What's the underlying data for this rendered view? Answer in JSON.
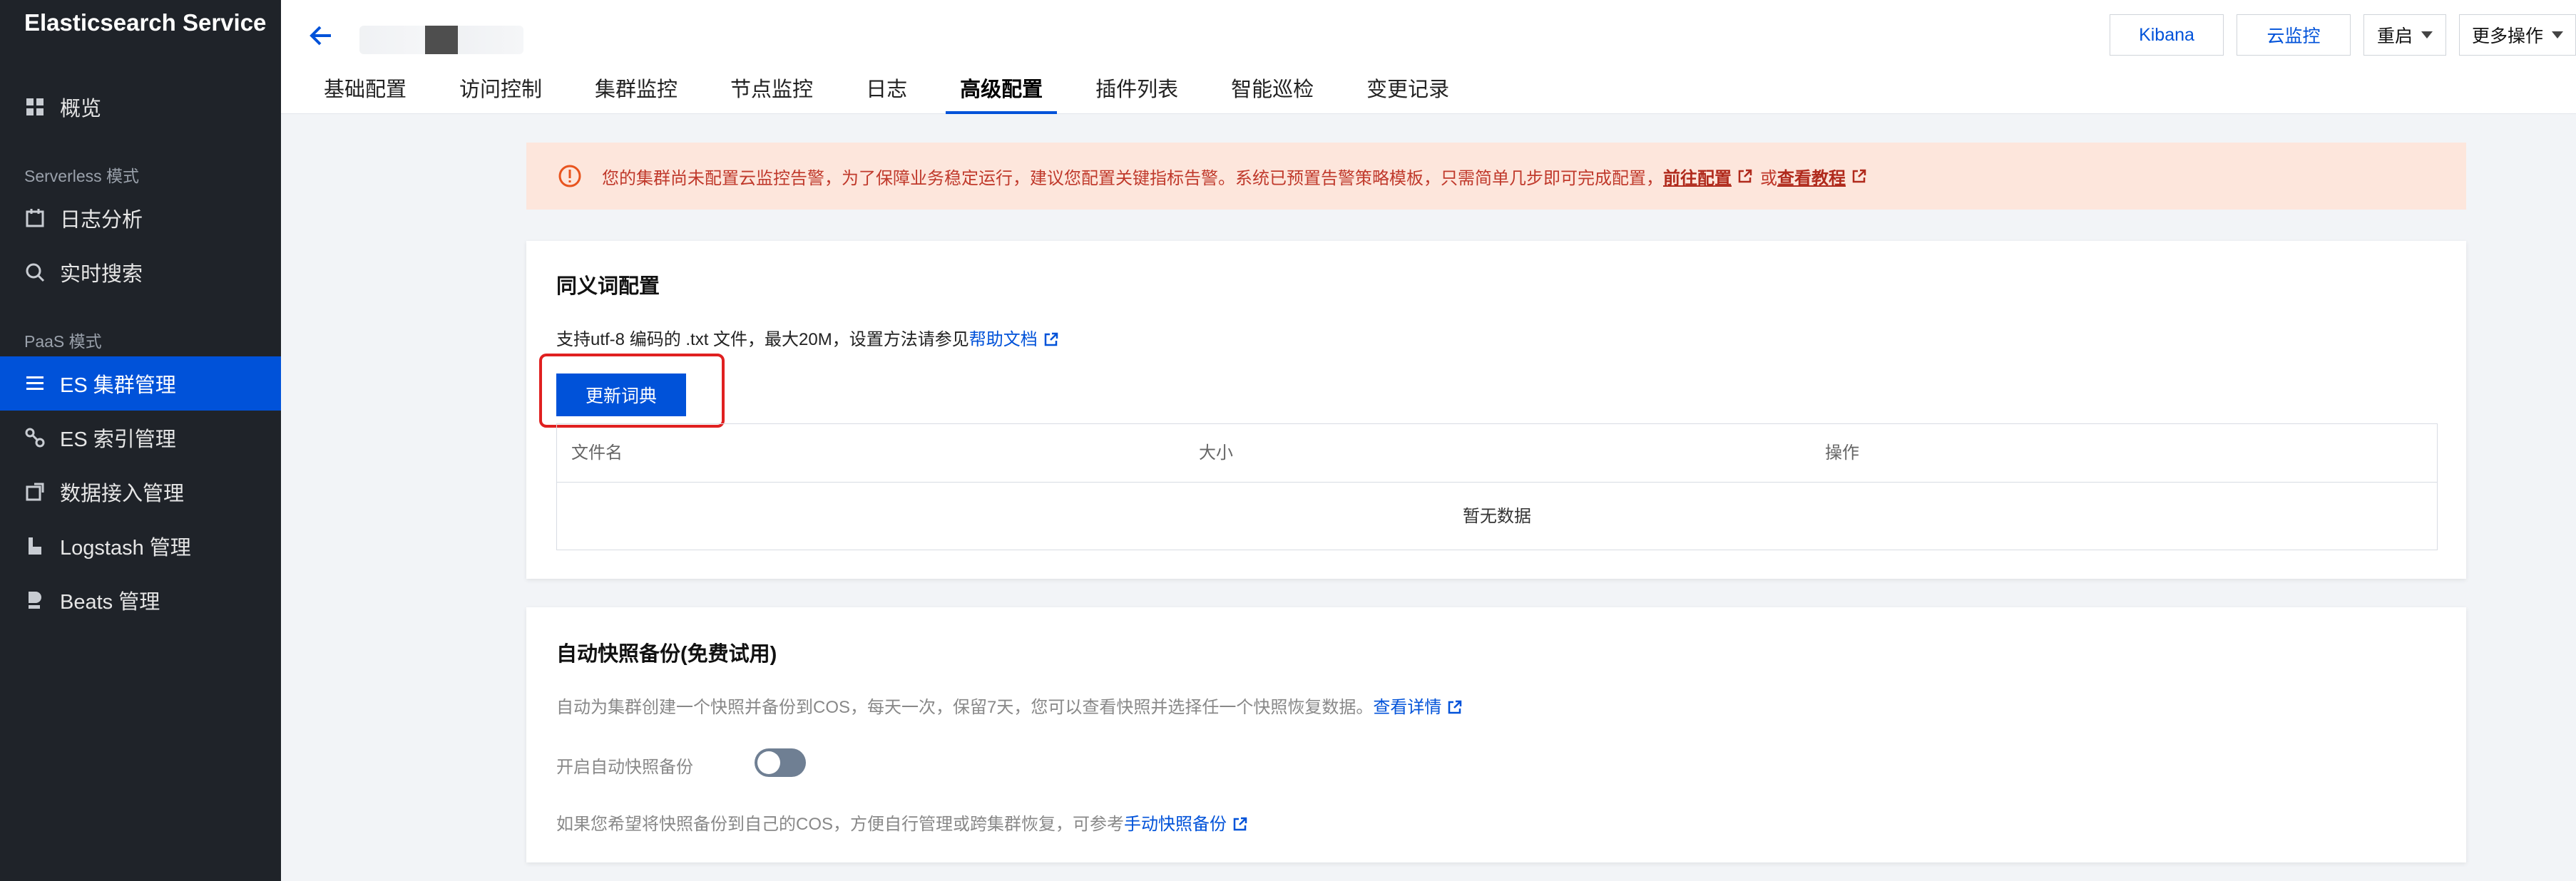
{
  "sidebar": {
    "brand": "Elasticsearch Service",
    "overview": "概览",
    "serverless_label": "Serverless 模式",
    "log_analysis": "日志分析",
    "realtime_search": "实时搜索",
    "paas_label": "PaaS 模式",
    "es_cluster": "ES 集群管理",
    "es_index": "ES 索引管理",
    "data_ingest": "数据接入管理",
    "logstash": "Logstash 管理",
    "beats": "Beats 管理"
  },
  "header": {
    "tabs": [
      "基础配置",
      "访问控制",
      "集群监控",
      "节点监控",
      "日志",
      "高级配置",
      "插件列表",
      "智能巡检",
      "变更记录"
    ],
    "active_tab": "高级配置",
    "buttons": {
      "kibana": "Kibana",
      "cloud_monitor": "云监控",
      "restart": "重启",
      "more_actions": "更多操作"
    }
  },
  "alert": {
    "text": "您的集群尚未配置云监控告警，为了保障业务稳定运行，建议您配置关键指标告警。系统已预置告警策略模板，只需简单几步即可完成配置，",
    "link1": "前往配置",
    "or": "或",
    "link2": "查看教程"
  },
  "synonym": {
    "title": "同义词配置",
    "desc": "支持utf-8 编码的 .txt 文件，最大20M，设置方法请参见",
    "help_link": "帮助文档",
    "update_button": "更新词典",
    "columns": [
      "文件名",
      "大小",
      "操作"
    ],
    "empty": "暂无数据"
  },
  "snapshot": {
    "title": "自动快照备份(免费试用)",
    "desc": "自动为集群创建一个快照并备份到COS，每天一次，保留7天，您可以查看快照并选择任一个快照恢复数据。",
    "details_link": "查看详情",
    "toggle_label": "开启自动快照备份",
    "toggle_on": false,
    "manual_desc": "如果您希望将快照备份到自己的COS，方便自行管理或跨集群恢复，可参考",
    "manual_link": "手动快照备份"
  },
  "colors": {
    "sidebar_bg": "#1f2329",
    "accent": "#0052d9",
    "alert_bg": "#fde6dc",
    "alert_text": "#c0392b",
    "highlight": "#e02020"
  }
}
